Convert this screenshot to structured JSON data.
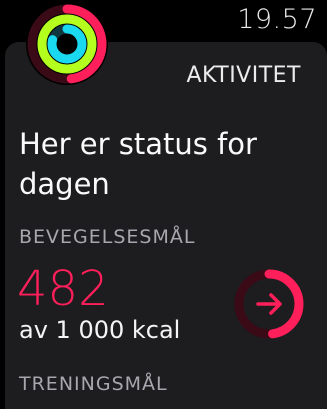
{
  "status_bar": {
    "time": "19.57"
  },
  "app": {
    "icon": "activity-rings-icon",
    "name": "AKTIVITET"
  },
  "notification": {
    "headline": "Her er status for dagen",
    "move": {
      "title": "BEVEGELSESMÅL",
      "value": "482",
      "goal_text": "av 1 000 kcal",
      "progress_fraction": 0.48,
      "icon": "arrow-right-icon"
    },
    "exercise": {
      "title": "TRENINGSMÅL"
    }
  },
  "colors": {
    "move_red": "#ff1f5a",
    "exercise_green": "#b4ff1e",
    "stand_cyan": "#19d8f0",
    "background": "#000000",
    "card": "#1d1d1f"
  }
}
